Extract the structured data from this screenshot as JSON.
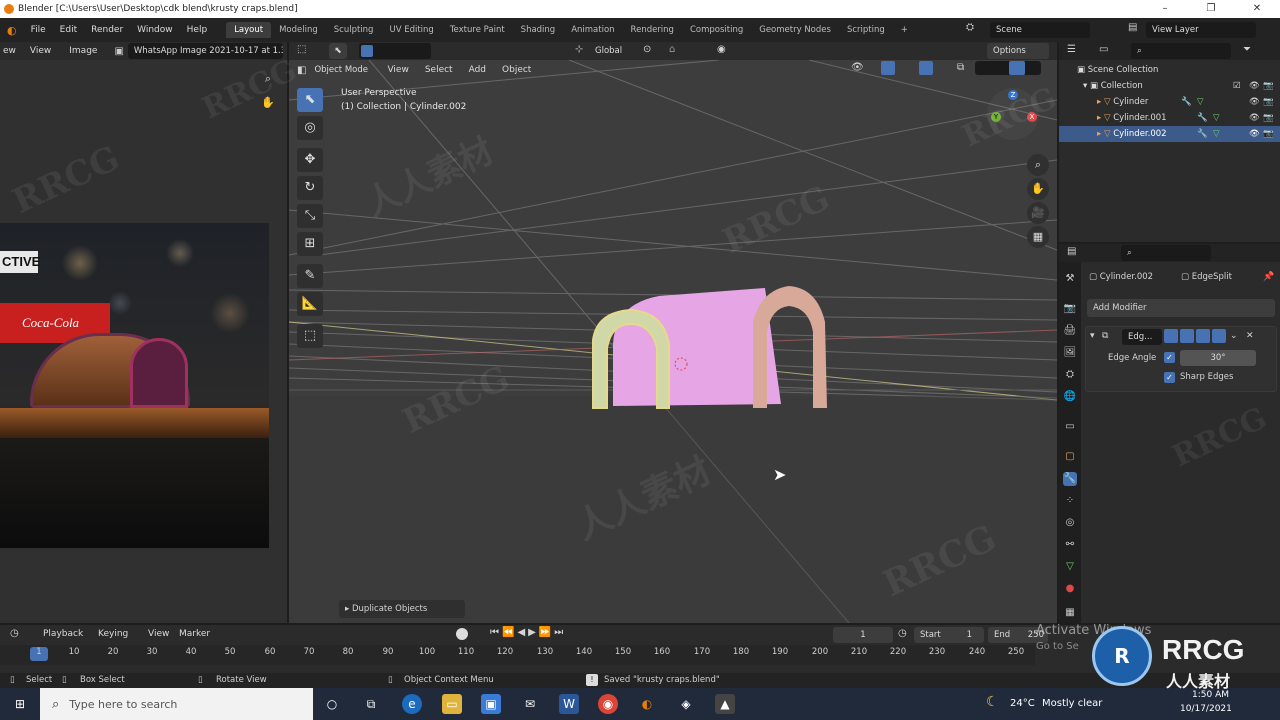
{
  "titlebar": {
    "title": "Blender [C:\\Users\\User\\Desktop\\cdk blend\\krusty craps.blend]",
    "minimize": "–",
    "maximize": "❐",
    "close": "✕"
  },
  "menu": {
    "items": [
      "File",
      "Edit",
      "Render",
      "Window",
      "Help"
    ],
    "workspaces": [
      "Layout",
      "Modeling",
      "Sculpting",
      "UV Editing",
      "Texture Paint",
      "Shading",
      "Animation",
      "Rendering",
      "Compositing",
      "Geometry Nodes",
      "Scripting"
    ],
    "active_workspace": "Layout",
    "add_tab": "+",
    "scene": "Scene",
    "view_layer": "View Layer"
  },
  "image_editor": {
    "menus": [
      "ew",
      "View",
      "Image"
    ],
    "image_name": "WhatsApp Image 2021-10-17 at 1.3",
    "photo_sign": "CTIVE",
    "photo_brand": "Coca-Cola"
  },
  "viewport": {
    "mode": "Object Mode",
    "menus": [
      "View",
      "Select",
      "Add",
      "Object"
    ],
    "orientation": "Global",
    "options": "Options",
    "perspective": "User Perspective",
    "collection_info": "(1) Collection | Cylinder.002",
    "last_op": "Duplicate Objects",
    "gizmo": {
      "z": "Z",
      "y": "Y",
      "x": "X"
    }
  },
  "outliner": {
    "root": "Scene Collection",
    "collection": "Collection",
    "objects": [
      "Cylinder",
      "Cylinder.001",
      "Cylinder.002"
    ],
    "selected_index": 2
  },
  "properties": {
    "object": "Cylinder.002",
    "modifier_name_header": "EdgeSplit",
    "add_modifier": "Add Modifier",
    "modifier_short": "Edg...",
    "edge_angle_label": "Edge Angle",
    "edge_angle_value": "30°",
    "edge_angle_checked": true,
    "sharp_edges_label": "Sharp Edges",
    "sharp_edges_checked": true
  },
  "timeline": {
    "menus": [
      "Playback",
      "Keying",
      "View",
      "Marker"
    ],
    "current_frame": "1",
    "start_label": "Start",
    "start": "1",
    "end_label": "End",
    "end": "250",
    "ticks": [
      "1",
      "10",
      "20",
      "30",
      "40",
      "50",
      "60",
      "70",
      "80",
      "90",
      "100",
      "110",
      "120",
      "130",
      "140",
      "150",
      "160",
      "170",
      "180",
      "190",
      "200",
      "210",
      "220",
      "230",
      "240",
      "250"
    ],
    "activate_windows": "Activate Windows",
    "activate_windows_sub": "Go to Se"
  },
  "status": {
    "select": "Select",
    "box_select": "Box Select",
    "rotate_view": "Rotate View",
    "context_menu": "Object Context Menu",
    "saved": "Saved \"krusty craps.blend\""
  },
  "taskbar": {
    "search_placeholder": "Type here to search",
    "temperature": "24°C",
    "weather": "Mostly clear",
    "time": "1:50 AM",
    "date": "10/17/2021"
  },
  "watermark": {
    "brand": "RRCG",
    "cn": "人人素材"
  },
  "colors": {
    "accent": "#4772b3",
    "selected_row": "#3c5a8a",
    "object_fill": "#e6a6e6",
    "arch_outline": "#e6d98a"
  }
}
